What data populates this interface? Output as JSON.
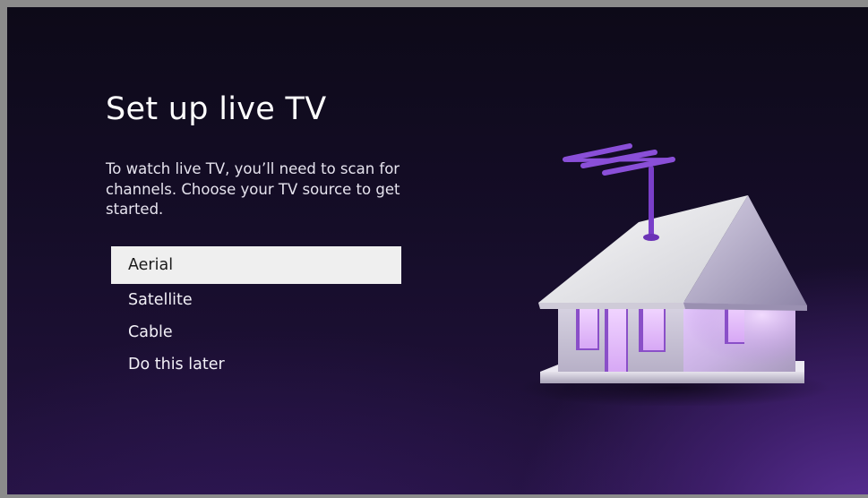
{
  "screen": {
    "title": "Set up live TV",
    "description": "To watch live TV, you’ll need to scan for channels. Choose your TV source to get started."
  },
  "menu": {
    "selected_index": 0,
    "items": [
      {
        "label": "Aerial"
      },
      {
        "label": "Satellite"
      },
      {
        "label": "Cable"
      },
      {
        "label": "Do this later"
      }
    ]
  },
  "illustration": {
    "icon": "house-with-antenna-icon"
  },
  "colors": {
    "background_top": "#0d0a18",
    "background_glow": "#5a2f96",
    "selection_bg": "#efefef",
    "accent_purple": "#7a3fc9",
    "window_glow": "#e9c6ff"
  }
}
